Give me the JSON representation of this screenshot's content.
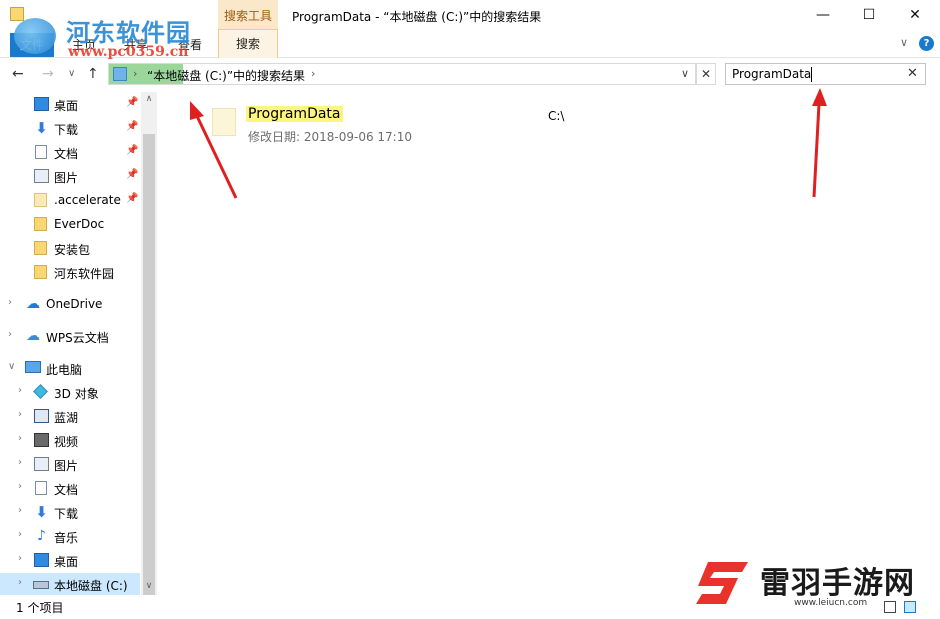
{
  "window": {
    "title": "ProgramData - “本地磁盘 (C:)”中的搜索结果",
    "tools_tab": "搜索工具",
    "minimize": "—",
    "maximize": "☐",
    "close": "✕"
  },
  "ribbon": {
    "tabs": [
      {
        "label": "文件"
      },
      {
        "label": "主页"
      },
      {
        "label": "共享"
      },
      {
        "label": "查看"
      },
      {
        "label": "搜索"
      }
    ],
    "collapse_glyph": "∨",
    "help_glyph": "?"
  },
  "watermark": {
    "text": "河东软件园",
    "url": "www.pc0359.cn"
  },
  "address": {
    "back": "←",
    "forward": "→",
    "recent": "∨",
    "up": "↑",
    "separator": "›",
    "path": "“本地磁盘 (C:)”中的搜索结果",
    "dropdown": "∨",
    "clear": "✕"
  },
  "search": {
    "value": "ProgramData",
    "clear": "✕"
  },
  "sidebar": {
    "quick_access": [
      {
        "label": "桌面",
        "icon": "desktop-icon",
        "pinned": true
      },
      {
        "label": "下载",
        "icon": "download-icon",
        "pinned": true
      },
      {
        "label": "文档",
        "icon": "document-icon",
        "pinned": true
      },
      {
        "label": "图片",
        "icon": "picture-icon",
        "pinned": true
      },
      {
        "label": ".accelerate",
        "icon": "folder-icon",
        "pinned": true
      },
      {
        "label": "EverDoc",
        "icon": "folder-icon",
        "pinned": false
      },
      {
        "label": "安装包",
        "icon": "folder-icon",
        "pinned": false
      },
      {
        "label": "河东软件园",
        "icon": "folder-icon",
        "pinned": false
      }
    ],
    "pin_glyph": "📌",
    "onedrive": "OneDrive",
    "wps": "WPS云文档",
    "this_pc": "此电脑",
    "pc_items": [
      {
        "label": "3D 对象",
        "icon": "3d-objects-icon"
      },
      {
        "label": "蓝湖",
        "icon": "lanhu-icon"
      },
      {
        "label": "视频",
        "icon": "video-icon"
      },
      {
        "label": "图片",
        "icon": "picture-icon"
      },
      {
        "label": "文档",
        "icon": "document-icon"
      },
      {
        "label": "下载",
        "icon": "download-icon"
      },
      {
        "label": "音乐",
        "icon": "music-icon"
      },
      {
        "label": "桌面",
        "icon": "desktop-icon"
      },
      {
        "label": "本地磁盘 (C:)",
        "icon": "drive-icon"
      }
    ],
    "expand_glyph": "›",
    "expanded_glyph": "∨"
  },
  "scrollbar": {
    "up": "∧",
    "down": "∨"
  },
  "results": [
    {
      "name": "ProgramData",
      "modified_label": "修改日期: 2018-09-06 17:10",
      "path": "C:\\"
    }
  ],
  "status": {
    "count": "1 个项目"
  },
  "brand": {
    "name": "雷羽手游网",
    "url": "www.leiucn.com"
  },
  "colors": {
    "accent": "#1979ca",
    "search_tools_tab": "#fbe7ca",
    "highlight": "#fdf67c",
    "arrow": "#e02020"
  }
}
